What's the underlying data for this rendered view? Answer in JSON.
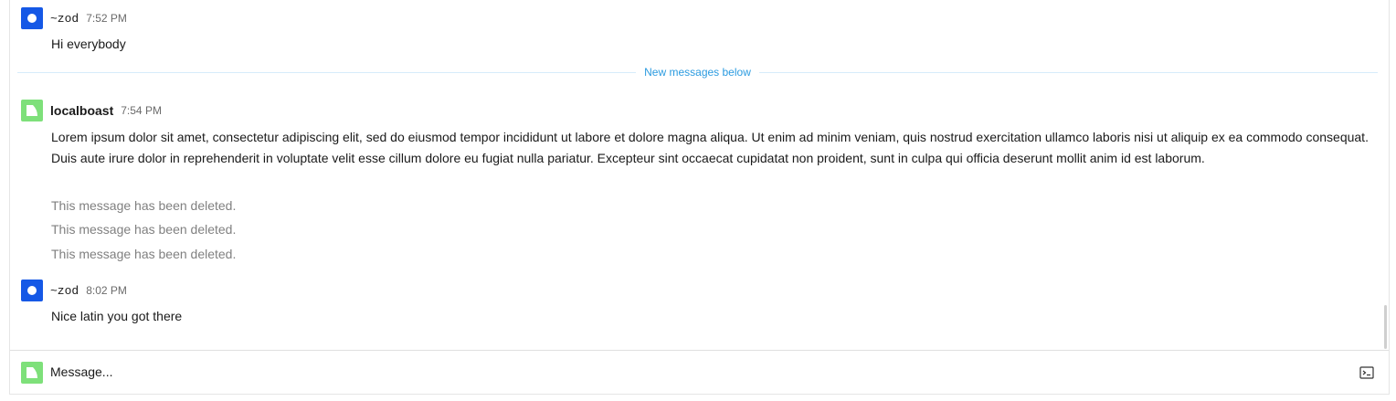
{
  "messages": [
    {
      "author": "~zod",
      "time": "7:52 PM",
      "avatar_color": "#1558e6",
      "text": "Hi everybody"
    },
    {
      "author": "localboast",
      "time": "7:54 PM",
      "avatar_color": "#7ee07a",
      "text": "Lorem ipsum dolor sit amet, consectetur adipiscing elit, sed do eiusmod tempor incididunt ut labore et dolore magna aliqua. Ut enim ad minim veniam, quis nostrud exercitation ullamco laboris nisi ut aliquip ex ea commodo consequat. Duis aute irure dolor in reprehenderit in voluptate velit esse cillum dolore eu fugiat nulla pariatur. Excepteur sint occaecat cupidatat non proident, sunt in culpa qui officia deserunt mollit anim id est laborum.",
      "deleted": [
        "This message has been deleted.",
        "This message has been deleted.",
        "This message has been deleted."
      ]
    },
    {
      "author": "~zod",
      "time": "8:02 PM",
      "avatar_color": "#1558e6",
      "text": "Nice latin you got there"
    }
  ],
  "divider": {
    "label": "New messages below",
    "color": "#2b9be0"
  },
  "composer": {
    "placeholder": "Message...",
    "value": "",
    "avatar_color": "#7ee07a",
    "icon": "terminal-icon"
  }
}
